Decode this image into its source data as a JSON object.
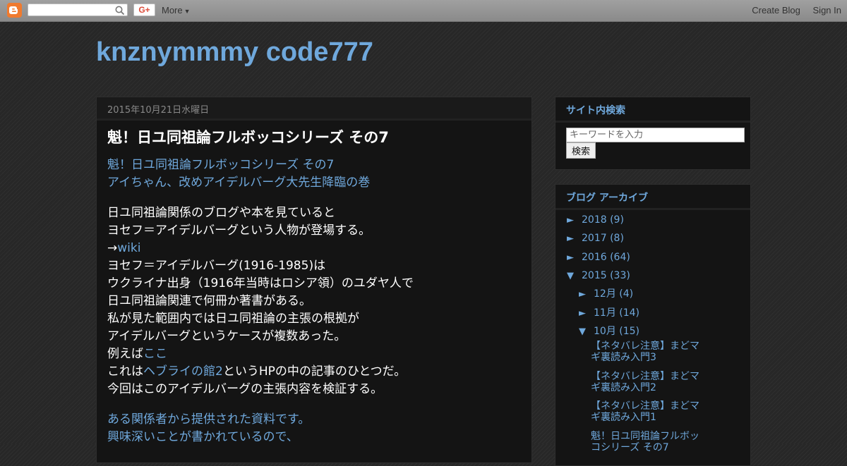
{
  "navbar": {
    "more_label": "More",
    "gplus_label": "G+",
    "create_blog": "Create Blog",
    "sign_in": "Sign In"
  },
  "blog": {
    "title": "knznymmmy code777"
  },
  "post": {
    "date": "2015年10月21日水曜日",
    "title": "魁！日ユ同祖論フルボッコシリーズ その7",
    "intro": [
      "魁！日ユ同祖論フルボッコシリーズ その7",
      "アイちゃん、改めアイデルバーグ大先生降臨の巻"
    ],
    "para": {
      "l1": "日ユ同祖論関係のブログや本を見ていると",
      "l2": "ヨセフ＝アイデルバーグという人物が登場する。",
      "l3_arrow": "→",
      "l3_link": "wiki",
      "l4": "ヨセフ＝アイデルバーグ(1916-1985)は",
      "l5": "ウクライナ出身（1916年当時はロシア領）のユダヤ人で",
      "l6": "日ユ同祖論関連で何冊か著書がある。",
      "l7": "私が見た範囲内では日ユ同祖論の主張の根拠が",
      "l8": "アイデルバーグというケースが複数あった。",
      "l9_text": "例えば",
      "l9_link": "ここ",
      "l10_pre": "これは",
      "l10_link": "ヘブライの館2",
      "l10_post": "というHPの中の記事のひとつだ。",
      "l11": "今回はこのアイデルバーグの主張内容を検証する。"
    },
    "tail": [
      "ある関係者から提供された資料です。",
      "興味深いことが書かれているので、"
    ]
  },
  "sidebar": {
    "search": {
      "title": "サイト内検索",
      "placeholder": "キーワードを入力",
      "button": "検索"
    },
    "archive": {
      "title": "ブログ アーカイブ",
      "expanded": "▼",
      "collapsed": "►",
      "years": [
        {
          "label": "2018",
          "count": "(9)"
        },
        {
          "label": "2017",
          "count": "(8)"
        },
        {
          "label": "2016",
          "count": "(64)"
        },
        {
          "label": "2015",
          "count": "(33)"
        }
      ],
      "months": [
        {
          "label": "12月",
          "count": "(4)"
        },
        {
          "label": "11月",
          "count": "(14)"
        },
        {
          "label": "10月",
          "count": "(15)"
        }
      ],
      "posts": [
        "【ネタバレ注意】まどマギ裏読み入門3",
        "【ネタバレ注意】まどマギ裏読み入門2",
        "【ネタバレ注意】まどマギ裏読み入門1",
        "魁！日ユ同祖論フルボッコシリーズ その7"
      ]
    }
  }
}
